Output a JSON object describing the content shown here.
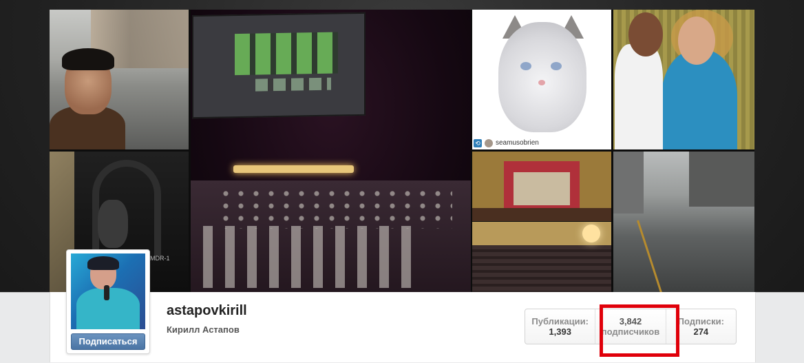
{
  "profile": {
    "username": "astapovkirill",
    "full_name": "Кирилл Астапов",
    "subscribe_label": "Подписаться"
  },
  "stats": {
    "posts": {
      "label": "Публикации:",
      "value": "1,393"
    },
    "followers": {
      "label": "подписчиков",
      "value": "3,842"
    },
    "following": {
      "label": "Подписки:",
      "value": "274"
    }
  },
  "photos": {
    "repost_username": "seamusobrien",
    "headphones_box_text": "MDR-1"
  },
  "colors": {
    "highlight": "#e0000a",
    "button": "#4a74a4"
  }
}
